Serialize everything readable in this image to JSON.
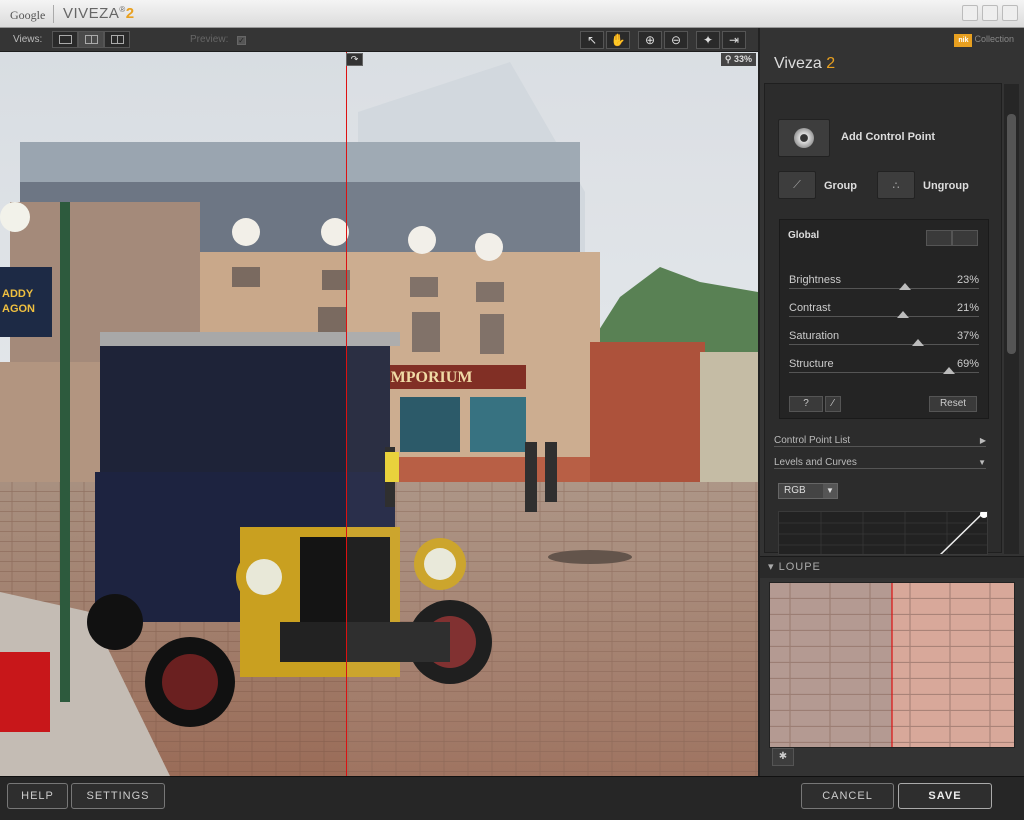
{
  "titlebar": {
    "google": "Google",
    "brand": "VIVEZA",
    "reg": "®",
    "version": "2"
  },
  "toolbar": {
    "views_label": "Views:",
    "preview_label": "Preview:",
    "preview_checked": true,
    "tools": [
      "arrow-tool",
      "hand-tool",
      "zoom-in",
      "zoom-out",
      "control-point-tool",
      "export"
    ]
  },
  "preview": {
    "zoom_level": "33%"
  },
  "panel": {
    "collection_badge": "nik",
    "collection_label": "Collection",
    "title": "Viveza",
    "title_version": "2",
    "add_control_point": "Add Control Point",
    "group": "Group",
    "ungroup": "Ungroup",
    "global": {
      "title": "Global",
      "sliders": [
        {
          "label": "Brightness",
          "value": "23%",
          "level": 0.61
        },
        {
          "label": "Contrast",
          "value": "21%",
          "level": 0.6
        },
        {
          "label": "Saturation",
          "value": "37%",
          "level": 0.68
        },
        {
          "label": "Structure",
          "value": "69%",
          "level": 0.84
        }
      ],
      "help_btn": "?",
      "reset": "Reset"
    },
    "control_point_list": "Control Point List",
    "levels_curves": "Levels and Curves",
    "channel": "RGB",
    "loupe": "LOUPE"
  },
  "bottom": {
    "help": "HELP",
    "settings": "SETTINGS",
    "cancel": "CANCEL",
    "save": "SAVE"
  },
  "colors": {
    "accent": "#e8a020",
    "split_line": "#dd1111"
  }
}
